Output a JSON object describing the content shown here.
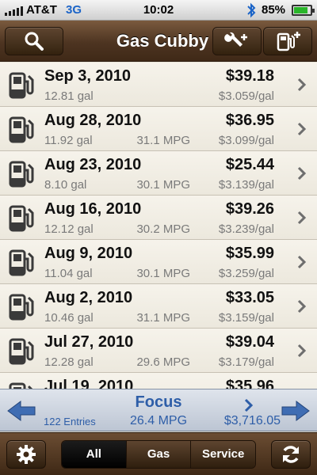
{
  "status_bar": {
    "carrier": "AT&T",
    "network": "3G",
    "time": "10:02",
    "battery_text": "85%",
    "battery_level": 0.85
  },
  "nav": {
    "title": "Gas Cubby",
    "search_icon": "search-icon",
    "wrench_add_icon": "wrench-add-icon",
    "pump_add_icon": "gas-pump-add-icon"
  },
  "entries": [
    {
      "date": "Sep 3, 2010",
      "gallons": "12.81 gal",
      "mpg": "",
      "price": "$39.18",
      "price_per_gal": "$3.059/gal"
    },
    {
      "date": "Aug 28, 2010",
      "gallons": "11.92 gal",
      "mpg": "31.1 MPG",
      "price": "$36.95",
      "price_per_gal": "$3.099/gal"
    },
    {
      "date": "Aug 23, 2010",
      "gallons": "8.10 gal",
      "mpg": "30.1 MPG",
      "price": "$25.44",
      "price_per_gal": "$3.139/gal"
    },
    {
      "date": "Aug 16, 2010",
      "gallons": "12.12 gal",
      "mpg": "30.2 MPG",
      "price": "$39.26",
      "price_per_gal": "$3.239/gal"
    },
    {
      "date": "Aug 9, 2010",
      "gallons": "11.04 gal",
      "mpg": "30.1 MPG",
      "price": "$35.99",
      "price_per_gal": "$3.259/gal"
    },
    {
      "date": "Aug 2, 2010",
      "gallons": "10.46 gal",
      "mpg": "31.1 MPG",
      "price": "$33.05",
      "price_per_gal": "$3.159/gal"
    },
    {
      "date": "Jul 27, 2010",
      "gallons": "12.28 gal",
      "mpg": "29.6 MPG",
      "price": "$39.04",
      "price_per_gal": "$3.179/gal"
    },
    {
      "date": "Jul 19, 2010",
      "gallons": "",
      "mpg": "",
      "price": "$35.96",
      "price_per_gal": ""
    }
  ],
  "summary": {
    "vehicle": "Focus",
    "entries": "122 Entries",
    "mpg": "26.4 MPG",
    "total": "$3,716.05"
  },
  "toolbar": {
    "segments": [
      "All",
      "Gas",
      "Service"
    ],
    "selected": "All"
  },
  "colors": {
    "nav_brown": "#4d3421",
    "accent_blue": "#2e5ea8",
    "battery_green": "#2ab52a"
  }
}
